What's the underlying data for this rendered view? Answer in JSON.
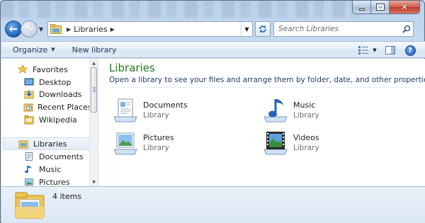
{
  "window": {
    "caption_buttons": [
      "minimize",
      "maximize",
      "close"
    ],
    "accent_color": "#1e7b1e"
  },
  "address_bar": {
    "path": [
      "Libraries"
    ],
    "search_placeholder": "Search Libraries"
  },
  "command_bar": {
    "organize_label": "Organize",
    "new_library_label": "New library"
  },
  "nav_pane": {
    "favorites_label": "Favorites",
    "favorites": [
      {
        "label": "Desktop",
        "icon": "desktop-icon"
      },
      {
        "label": "Downloads",
        "icon": "downloads-icon"
      },
      {
        "label": "Recent Places",
        "icon": "recent-places-icon"
      },
      {
        "label": "Wikipedia",
        "icon": "folder-icon"
      }
    ],
    "libraries_label": "Libraries",
    "libraries": [
      {
        "label": "Documents",
        "icon": "documents-icon"
      },
      {
        "label": "Music",
        "icon": "music-icon"
      },
      {
        "label": "Pictures",
        "icon": "pictures-icon"
      }
    ]
  },
  "content": {
    "title": "Libraries",
    "subtitle": "Open a library to see your files and arrange them by folder, date, and other properties.",
    "items": [
      {
        "name": "Documents",
        "type": "Library",
        "icon": "documents-library-icon"
      },
      {
        "name": "Music",
        "type": "Library",
        "icon": "music-library-icon"
      },
      {
        "name": "Pictures",
        "type": "Library",
        "icon": "pictures-library-icon"
      },
      {
        "name": "Videos",
        "type": "Library",
        "icon": "videos-library-icon"
      }
    ]
  },
  "details": {
    "item_count": "4 items"
  }
}
